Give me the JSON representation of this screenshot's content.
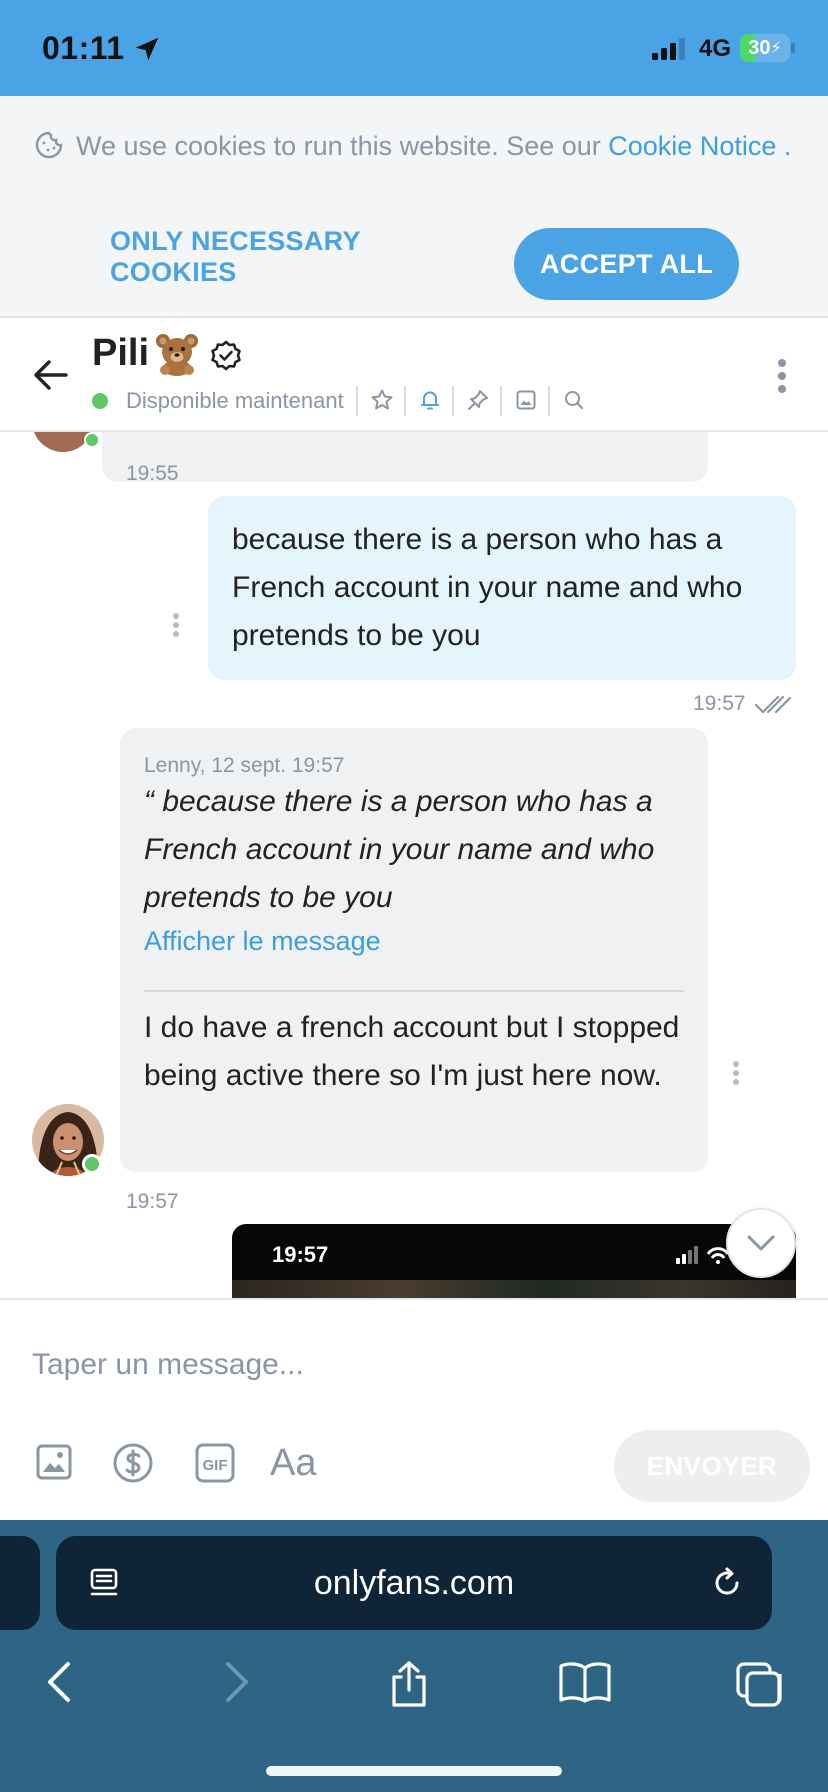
{
  "status_bar": {
    "time": "01:11",
    "network": "4G",
    "battery": {
      "label": "30",
      "level_percent": 30
    },
    "icons": [
      "location-arrow-icon",
      "signal-bars-icon",
      "battery-charging-icon"
    ]
  },
  "cookie_banner": {
    "text": "We use cookies to run this website. See our ",
    "link": "Cookie Notice",
    "suffix": " .",
    "necessary_button": "ONLY NECESSARY COOKIES",
    "accept_button": "ACCEPT ALL",
    "accent_color": "#4aa3e4"
  },
  "chat_header": {
    "name": "Pili",
    "status": "Disponible maintenant",
    "icons": [
      "back-arrow-icon",
      "teddy-bear-emoji",
      "verified-badge-icon",
      "star-icon",
      "bell-icon",
      "pin-icon",
      "image-icon",
      "search-icon",
      "more-vertical-icon"
    ]
  },
  "messages": {
    "time_1": "19:55",
    "outgoing": {
      "text": "because there is a person who has a French account in your name and who pretends to be you",
      "time": "19:57"
    },
    "incoming": {
      "quote_meta": "Lenny, 12 sept. 19:57",
      "quote_text": "“ because there is a person who has a French account in your name and who pretends to be you",
      "quote_link": "Afficher le message",
      "text": "I do have a french account but I stopped being active there so I'm just here now.",
      "time": "19:57"
    },
    "screenshot_time": "19:57"
  },
  "composer": {
    "placeholder": "Taper un message...",
    "font_button": "Aa",
    "send_button": "ENVOYER",
    "icons": [
      "image-icon",
      "dollar-icon",
      "gif-icon"
    ]
  },
  "browser": {
    "url": "onlyfans.com",
    "icons": [
      "tab-overview-icon",
      "reload-icon",
      "back-icon",
      "forward-icon",
      "share-icon",
      "bookmarks-icon",
      "tabs-icon"
    ]
  },
  "colors": {
    "brand_blue": "#4aa3e4",
    "outgoing_bubble": "#e5f4fd",
    "incoming_bubble": "#f0f1f3",
    "online_green": "#5cc964",
    "browser_bar": "#2e6585"
  }
}
